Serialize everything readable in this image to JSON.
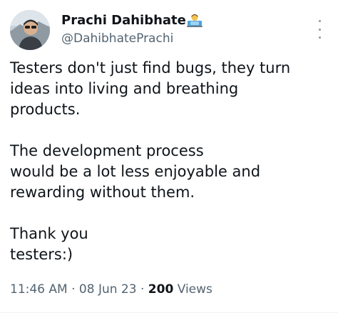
{
  "author": {
    "display_name": "Prachi Dahibhate",
    "handle": "@DahibhatePrachi",
    "emoji_icon": "technologist-emoji-icon",
    "avatar_icon": "profile-photo"
  },
  "tweet": {
    "lines": [
      "Testers don't just find bugs, they turn",
      "ideas into living and breathing",
      "products.",
      "",
      "The development process",
      "would be a lot less enjoyable and",
      "rewarding without them.",
      "",
      "Thank you",
      "testers:)"
    ]
  },
  "meta": {
    "time": "11:46 AM",
    "sep1": "·",
    "date": "08 Jun 23",
    "sep2": "·",
    "views_count": "200",
    "views_label": "Views"
  },
  "colors": {
    "text": "#0f1419",
    "secondary": "#536471",
    "divider": "#eff3f4"
  }
}
